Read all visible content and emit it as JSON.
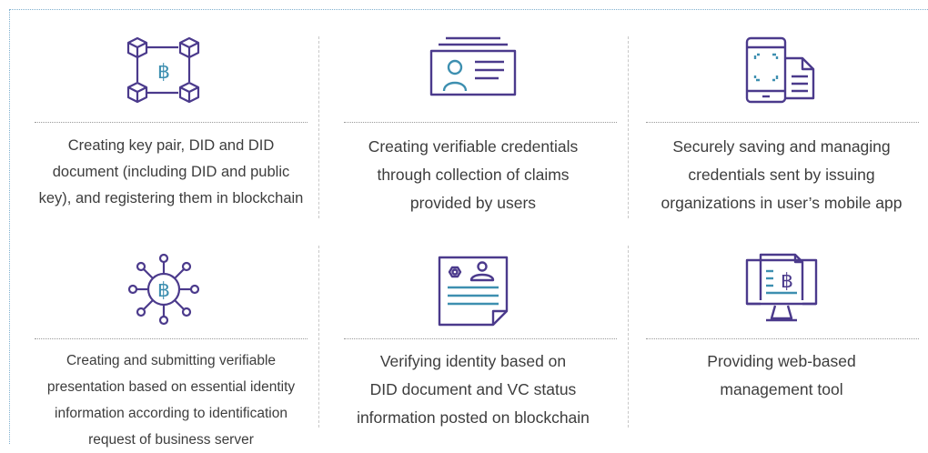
{
  "colors": {
    "icon_stroke": "#4b3a8c",
    "icon_accent": "#3d8fb0",
    "frame": "#7fb0cf",
    "divider": "#9a9a9a",
    "text": "#3d3d3d"
  },
  "items": [
    {
      "icon": "blockchain-network-icon",
      "symbol": "฿",
      "caption": [
        "Creating key pair, DID and DID",
        "document (including DID and public",
        "key), and registering them in blockchain"
      ]
    },
    {
      "icon": "credential-card-icon",
      "caption": [
        "Creating verifiable credentials",
        "through collection of claims",
        "provided by users"
      ]
    },
    {
      "icon": "mobile-document-icon",
      "caption": [
        "Securely saving and managing",
        "credentials sent by issuing",
        "organizations in user’s mobile app"
      ]
    },
    {
      "icon": "bitcoin-hub-icon",
      "symbol": "฿",
      "caption": [
        "Creating and submitting verifiable",
        "presentation based on essential identity",
        "information according to identification",
        "request of business server"
      ]
    },
    {
      "icon": "id-verification-icon",
      "caption": [
        "Verifying identity based on",
        "DID document and VC status",
        "information posted on blockchain"
      ]
    },
    {
      "icon": "web-monitor-icon",
      "symbol": "฿",
      "caption": [
        "Providing web-based",
        "management tool"
      ]
    }
  ]
}
